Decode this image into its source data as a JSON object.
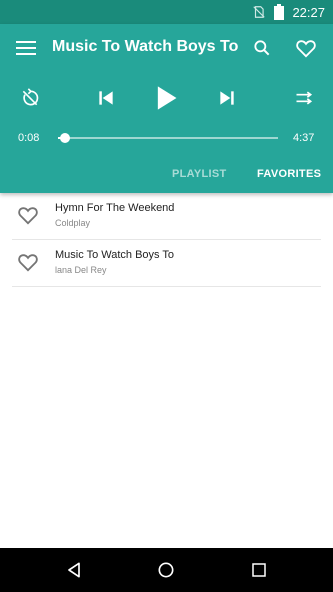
{
  "status_bar": {
    "time": "22:27",
    "icons": [
      "no-sim-icon",
      "battery-icon"
    ]
  },
  "toolbar": {
    "title": "Music To Watch Boys To",
    "icons": [
      "menu-icon",
      "search-icon",
      "heart-outline-icon"
    ]
  },
  "player": {
    "controls": [
      "repeat-off-icon",
      "skip-previous-icon",
      "play-icon",
      "skip-next-icon",
      "shuffle-icon"
    ],
    "elapsed": "0:08",
    "duration": "4:37",
    "progress_fraction": 0.03
  },
  "tabs": [
    {
      "label": "PLAYLIST",
      "active": false
    },
    {
      "label": "FAVORITES",
      "active": true
    }
  ],
  "songs": [
    {
      "title": "Hymn For The Weekend",
      "artist": "Coldplay"
    },
    {
      "title": "Music To Watch Boys To",
      "artist": "lana Del Rey"
    }
  ],
  "nav_bar": {
    "icons": [
      "back-icon",
      "home-icon",
      "recents-icon"
    ]
  },
  "colors": {
    "primary": "#26a69a",
    "status_bar": "#1a8b7b"
  }
}
